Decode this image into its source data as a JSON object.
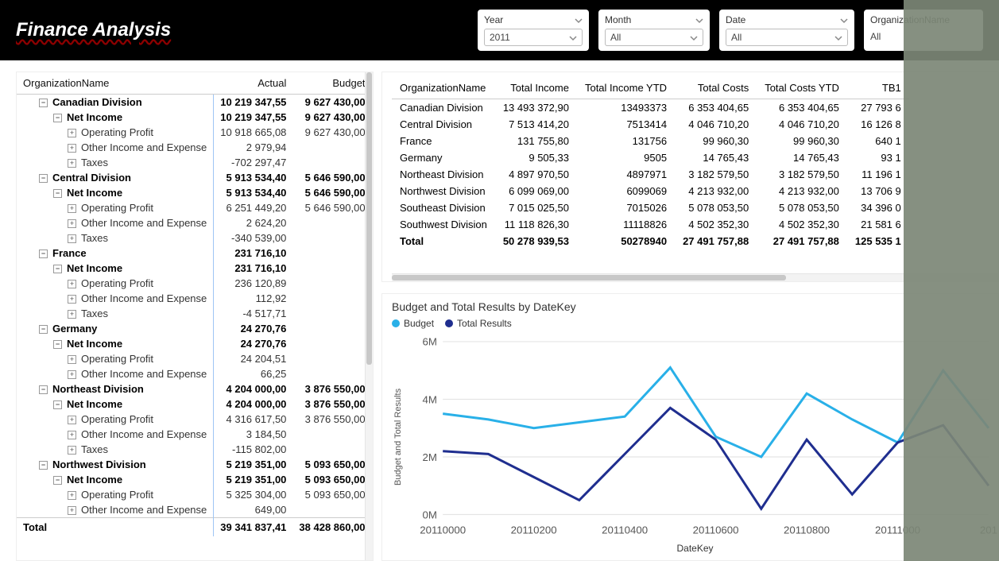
{
  "app_title": "Finance Analysis",
  "slicers": [
    {
      "label": "Year",
      "value": "2011"
    },
    {
      "label": "Month",
      "value": "All"
    },
    {
      "label": "Date",
      "value": "All"
    },
    {
      "label": "OrganizationName",
      "value": "All"
    }
  ],
  "matrix": {
    "headers": {
      "name": "OrganizationName",
      "actual": "Actual",
      "budget": "Budget"
    },
    "rows": [
      {
        "lvl": 0,
        "exp": "minus",
        "name": "Canadian Division",
        "actual": "10 219 347,55",
        "budget": "9 627 430,00"
      },
      {
        "lvl": 1,
        "exp": "minus",
        "name": "Net Income",
        "actual": "10 219 347,55",
        "budget": "9 627 430,00"
      },
      {
        "lvl": 2,
        "exp": "plus",
        "name": "Operating Profit",
        "actual": "10 918 665,08",
        "budget": "9 627 430,00"
      },
      {
        "lvl": 2,
        "exp": "plus",
        "name": "Other Income and Expense",
        "actual": "2 979,94",
        "budget": ""
      },
      {
        "lvl": 2,
        "exp": "plus",
        "name": "Taxes",
        "actual": "-702 297,47",
        "budget": ""
      },
      {
        "lvl": 0,
        "exp": "minus",
        "name": "Central Division",
        "actual": "5 913 534,40",
        "budget": "5 646 590,00"
      },
      {
        "lvl": 1,
        "exp": "minus",
        "name": "Net Income",
        "actual": "5 913 534,40",
        "budget": "5 646 590,00"
      },
      {
        "lvl": 2,
        "exp": "plus",
        "name": "Operating Profit",
        "actual": "6 251 449,20",
        "budget": "5 646 590,00"
      },
      {
        "lvl": 2,
        "exp": "plus",
        "name": "Other Income and Expense",
        "actual": "2 624,20",
        "budget": ""
      },
      {
        "lvl": 2,
        "exp": "plus",
        "name": "Taxes",
        "actual": "-340 539,00",
        "budget": ""
      },
      {
        "lvl": 0,
        "exp": "minus",
        "name": "France",
        "actual": "231 716,10",
        "budget": ""
      },
      {
        "lvl": 1,
        "exp": "minus",
        "name": "Net Income",
        "actual": "231 716,10",
        "budget": ""
      },
      {
        "lvl": 2,
        "exp": "plus",
        "name": "Operating Profit",
        "actual": "236 120,89",
        "budget": ""
      },
      {
        "lvl": 2,
        "exp": "plus",
        "name": "Other Income and Expense",
        "actual": "112,92",
        "budget": ""
      },
      {
        "lvl": 2,
        "exp": "plus",
        "name": "Taxes",
        "actual": "-4 517,71",
        "budget": ""
      },
      {
        "lvl": 0,
        "exp": "minus",
        "name": "Germany",
        "actual": "24 270,76",
        "budget": ""
      },
      {
        "lvl": 1,
        "exp": "minus",
        "name": "Net Income",
        "actual": "24 270,76",
        "budget": ""
      },
      {
        "lvl": 2,
        "exp": "plus",
        "name": "Operating Profit",
        "actual": "24 204,51",
        "budget": ""
      },
      {
        "lvl": 2,
        "exp": "plus",
        "name": "Other Income and Expense",
        "actual": "66,25",
        "budget": ""
      },
      {
        "lvl": 0,
        "exp": "minus",
        "name": "Northeast Division",
        "actual": "4 204 000,00",
        "budget": "3 876 550,00"
      },
      {
        "lvl": 1,
        "exp": "minus",
        "name": "Net Income",
        "actual": "4 204 000,00",
        "budget": "3 876 550,00"
      },
      {
        "lvl": 2,
        "exp": "plus",
        "name": "Operating Profit",
        "actual": "4 316 617,50",
        "budget": "3 876 550,00"
      },
      {
        "lvl": 2,
        "exp": "plus",
        "name": "Other Income and Expense",
        "actual": "3 184,50",
        "budget": ""
      },
      {
        "lvl": 2,
        "exp": "plus",
        "name": "Taxes",
        "actual": "-115 802,00",
        "budget": ""
      },
      {
        "lvl": 0,
        "exp": "minus",
        "name": "Northwest Division",
        "actual": "5 219 351,00",
        "budget": "5 093 650,00"
      },
      {
        "lvl": 1,
        "exp": "minus",
        "name": "Net Income",
        "actual": "5 219 351,00",
        "budget": "5 093 650,00"
      },
      {
        "lvl": 2,
        "exp": "plus",
        "name": "Operating Profit",
        "actual": "5 325 304,00",
        "budget": "5 093 650,00"
      },
      {
        "lvl": 2,
        "exp": "plus",
        "name": "Other Income and Expense",
        "actual": "649,00",
        "budget": ""
      }
    ],
    "total": {
      "name": "Total",
      "actual": "39 341 837,41",
      "budget": "38 428 860,00"
    }
  },
  "flat": {
    "headers": [
      "OrganizationName",
      "Total Income",
      "Total Income YTD",
      "Total Costs",
      "Total Costs YTD",
      "TB1"
    ],
    "rows": [
      [
        "Canadian Division",
        "13 493 372,90",
        "13493373",
        "6 353 404,65",
        "6 353 404,65",
        "27 793 6"
      ],
      [
        "Central Division",
        "7 513 414,20",
        "7513414",
        "4 046 710,20",
        "4 046 710,20",
        "16 126 8"
      ],
      [
        "France",
        "131 755,80",
        "131756",
        "99 960,30",
        "99 960,30",
        "640 1"
      ],
      [
        "Germany",
        "9 505,33",
        "9505",
        "14 765,43",
        "14 765,43",
        "93 1"
      ],
      [
        "Northeast Division",
        "4 897 970,50",
        "4897971",
        "3 182 579,50",
        "3 182 579,50",
        "11 196 1"
      ],
      [
        "Northwest Division",
        "6 099 069,00",
        "6099069",
        "4 213 932,00",
        "4 213 932,00",
        "13 706 9"
      ],
      [
        "Southeast Division",
        "7 015 025,50",
        "7015026",
        "5 078 053,50",
        "5 078 053,50",
        "34 396 0"
      ],
      [
        "Southwest Division",
        "11 118 826,30",
        "11118826",
        "4 502 352,30",
        "4 502 352,30",
        "21 581 6"
      ]
    ],
    "total": [
      "Total",
      "50 278 939,53",
      "50278940",
      "27 491 757,88",
      "27 491 757,88",
      "125 535 1"
    ]
  },
  "chart_data": {
    "type": "line",
    "title": "Budget and Total Results by DateKey",
    "xlabel": "DateKey",
    "ylabel": "Budget and Total Results",
    "x": [
      "20110000",
      "20110100",
      "20110200",
      "20110300",
      "20110400",
      "20110500",
      "20110600",
      "20110700",
      "20110800",
      "20110900",
      "20111000",
      "20111100",
      "20111200"
    ],
    "xticks": [
      "20110000",
      "20110200",
      "20110400",
      "20110600",
      "20110800",
      "20111000",
      "201"
    ],
    "ylim": [
      0,
      6000000
    ],
    "yticks": [
      "0M",
      "2M",
      "4M",
      "6M"
    ],
    "series": [
      {
        "name": "Budget",
        "color": "#29b0e8",
        "values": [
          3500000,
          3300000,
          3000000,
          3200000,
          3400000,
          5100000,
          2700000,
          2000000,
          4200000,
          3300000,
          2500000,
          5000000,
          3000000
        ]
      },
      {
        "name": "Total Results",
        "color": "#1f2e8f",
        "values": [
          2200000,
          2100000,
          1300000,
          500000,
          2100000,
          3700000,
          2600000,
          200000,
          2600000,
          700000,
          2500000,
          3100000,
          1000000
        ]
      }
    ]
  },
  "legend_labels": {
    "budget": "Budget",
    "total": "Total Results"
  }
}
